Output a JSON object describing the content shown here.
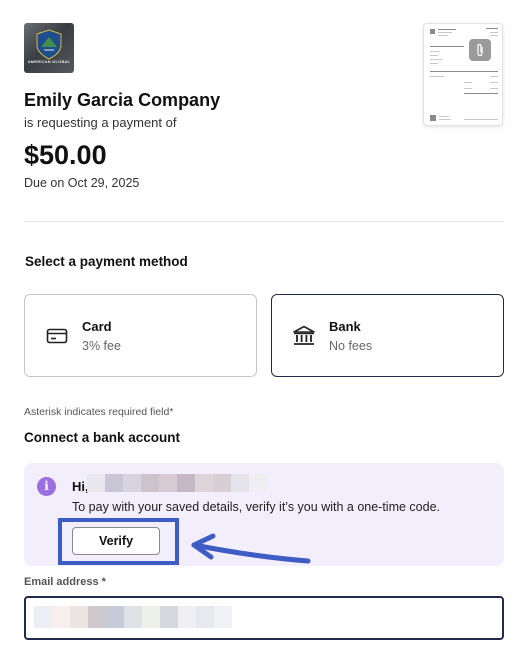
{
  "header": {
    "company_name": "Emily Garcia Company",
    "requesting_text": "is requesting a payment of",
    "amount": "$50.00",
    "due_text": "Due on Oct 29, 2025",
    "logo_text": "AMERICAN GLOBAL"
  },
  "payment": {
    "section_title": "Select a payment method",
    "methods": [
      {
        "label": "Card",
        "sub": "3% fee",
        "icon": "credit-card-icon"
      },
      {
        "label": "Bank",
        "sub": "No fees",
        "icon": "bank-icon"
      }
    ]
  },
  "form": {
    "asterisk_note": "Asterisk indicates required field*",
    "connect_title": "Connect a bank account",
    "info": {
      "greeting": "Hi,",
      "message": "To pay with your saved details, verify it’s you with a one-time code.",
      "verify_label": "Verify"
    },
    "email_label": "Email address *"
  },
  "colors": {
    "accent_navy": "#1e2b4a",
    "info_bg": "#f2eefb",
    "info_icon": "#9a6fe0",
    "annotation_blue": "#3d5cc4"
  }
}
